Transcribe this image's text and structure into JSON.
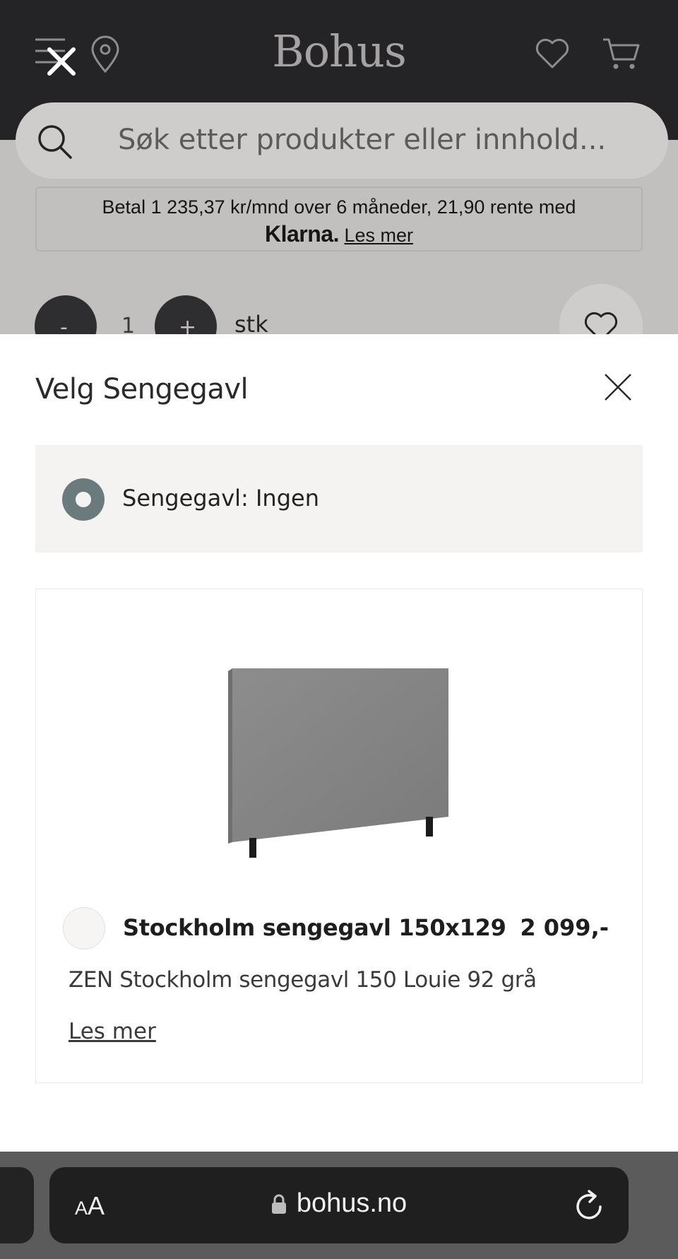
{
  "header": {
    "logo": "Bohus",
    "icons": [
      "menu-icon",
      "close-icon",
      "location-pin-icon",
      "heart-icon",
      "cart-icon"
    ]
  },
  "search": {
    "placeholder": "Søk etter produkter eller innhold..."
  },
  "klarna": {
    "text": "Betal 1 235,37 kr/mnd over 6 måneder, 21,90 rente med",
    "brand": "Klarna.",
    "link": "Les mer"
  },
  "quantity": {
    "minus": "-",
    "value": "1",
    "plus": "+",
    "unit": "stk"
  },
  "modal": {
    "title": "Velg Sengegavl",
    "option_none": {
      "label": "Sengegavl: Ingen",
      "selected": true
    },
    "product": {
      "name": "Stockholm sengegavl 150x129",
      "price": "2 099,-",
      "description": "ZEN Stockholm sengegavl 150 Louie 92 grå",
      "link": "Les mer",
      "selected": false
    }
  },
  "browser": {
    "text_size": "AA",
    "url": "bohus.no"
  },
  "colors": {
    "header_bg": "#242326",
    "radio_selected": "#6b7b7d",
    "option_bg": "#f4f3f2",
    "browser_bar": "#1f1f20"
  }
}
